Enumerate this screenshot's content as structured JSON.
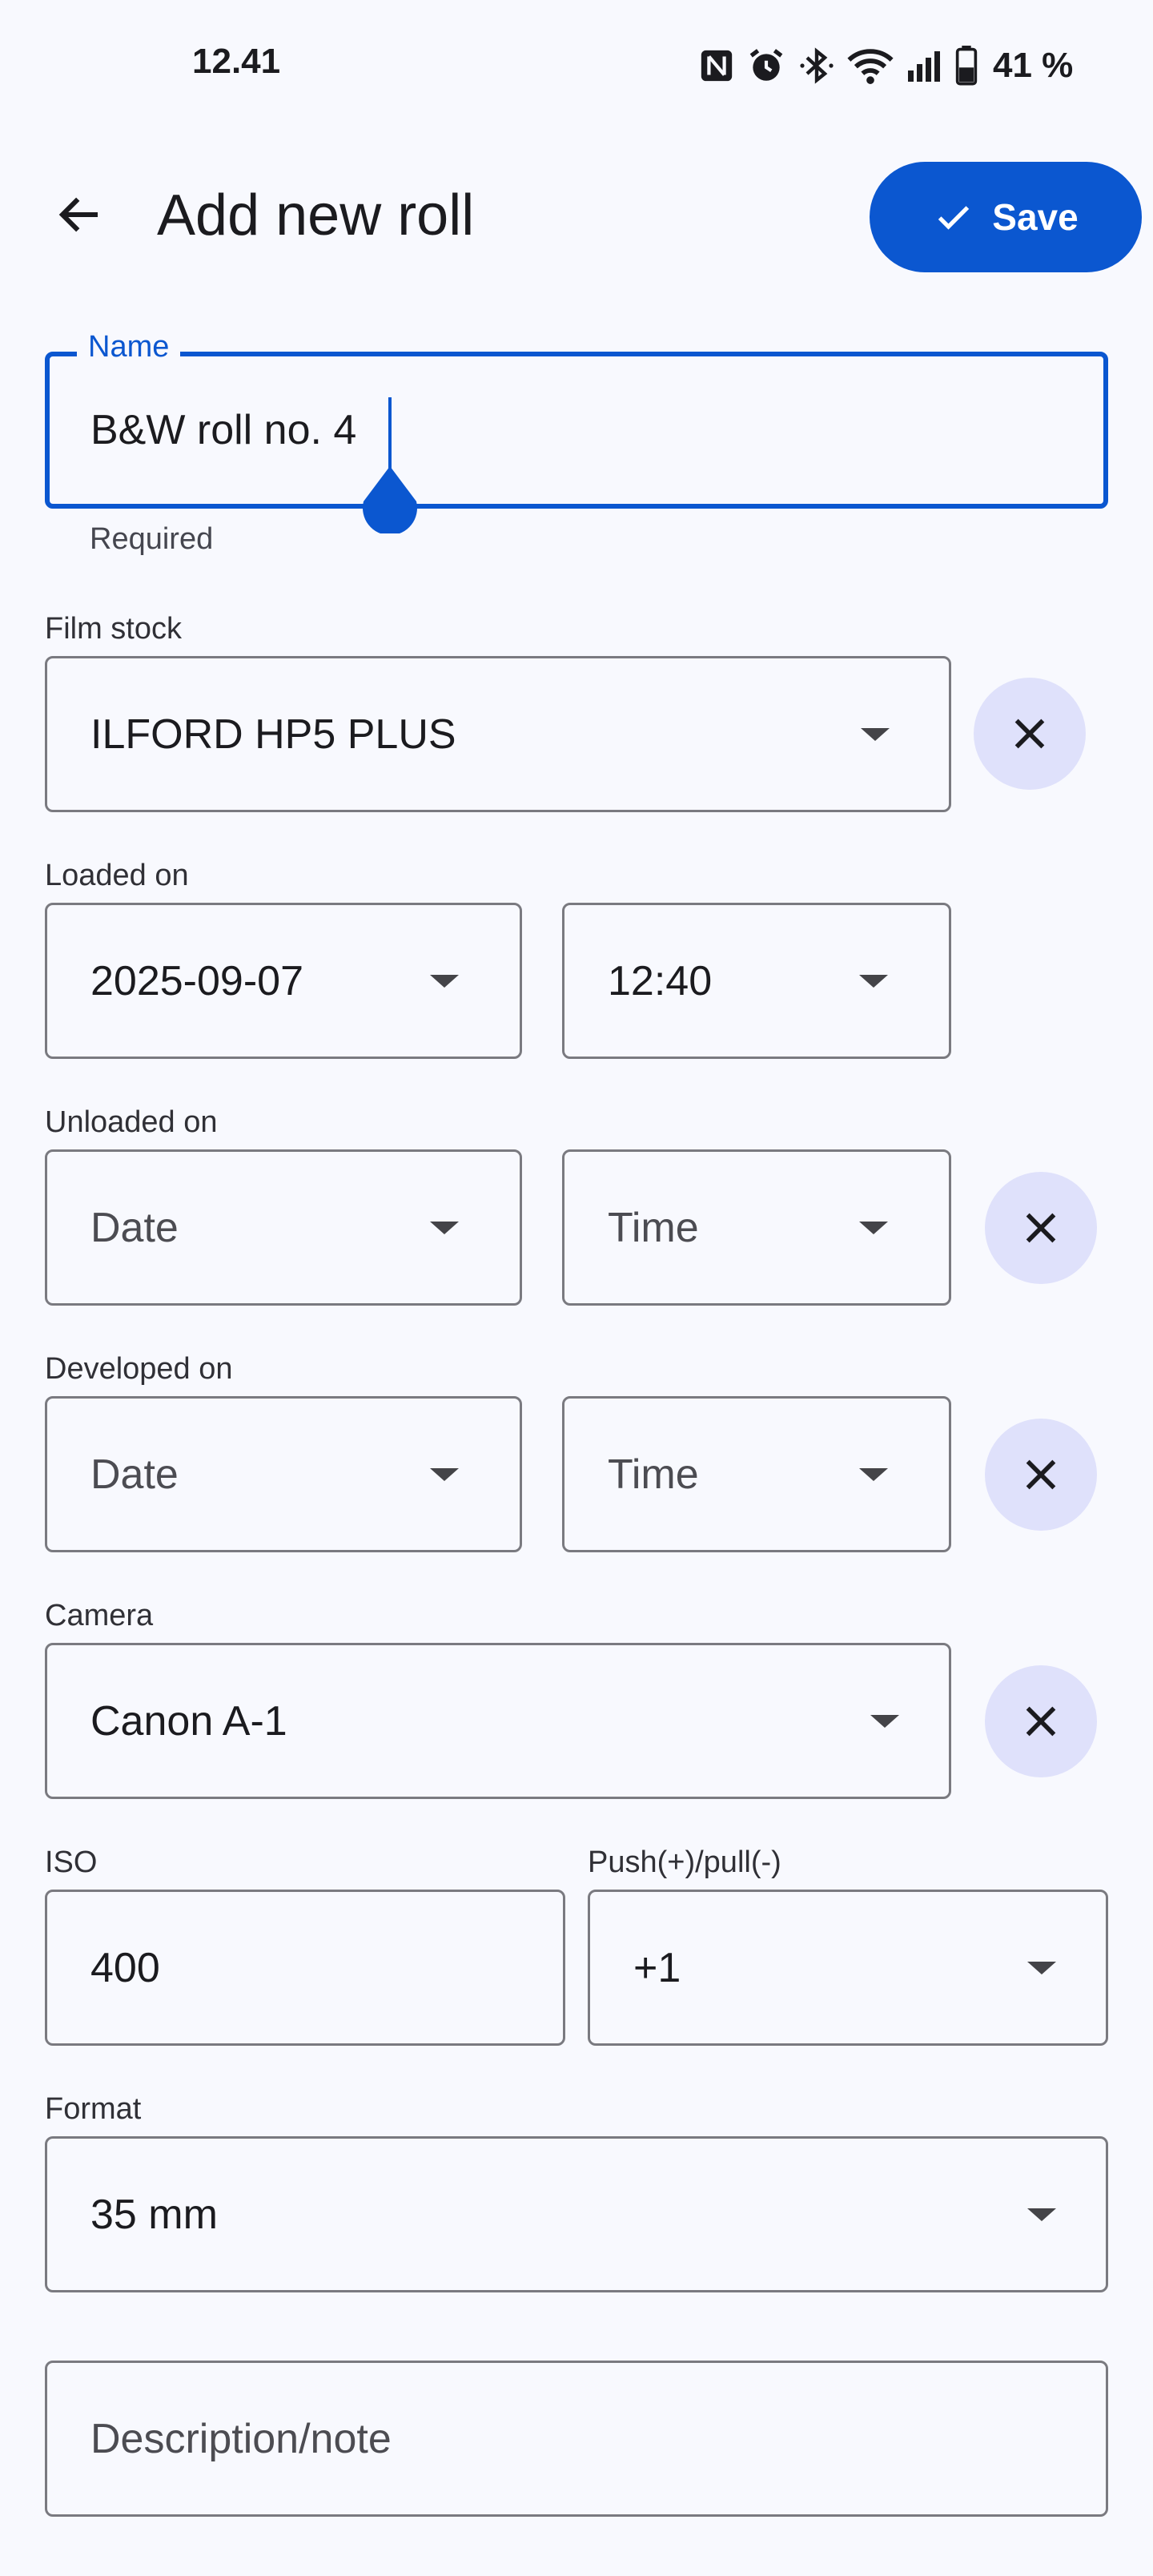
{
  "status_bar": {
    "time": "12.41",
    "battery": "41 %",
    "icons": [
      "nfc-icon",
      "alarm-icon",
      "bluetooth-icon",
      "wifi-icon",
      "signal-icon",
      "battery-icon"
    ]
  },
  "app_bar": {
    "title": "Add new roll",
    "save_label": "Save",
    "back_icon": "arrow-back-icon",
    "save_icon": "check-icon"
  },
  "form": {
    "name": {
      "label": "Name",
      "value": "B&W roll no. 4",
      "helper": "Required"
    },
    "film_stock": {
      "label": "Film stock",
      "value": "ILFORD HP5 PLUS"
    },
    "loaded_on": {
      "label": "Loaded on",
      "date": "2025-09-07",
      "time": "12:40"
    },
    "unloaded_on": {
      "label": "Unloaded on",
      "date": "Date",
      "time": "Time"
    },
    "developed_on": {
      "label": "Developed on",
      "date": "Date",
      "time": "Time"
    },
    "camera": {
      "label": "Camera",
      "value": "Canon A-1"
    },
    "iso": {
      "label": "ISO",
      "value": "400"
    },
    "push_pull": {
      "label": "Push(+)/pull(-)",
      "value": "+1"
    },
    "format": {
      "label": "Format",
      "value": "35 mm"
    },
    "description": {
      "placeholder": "Description/note"
    }
  },
  "colors": {
    "accent": "#0b57d0",
    "background": "#f8f9fe",
    "clear_button_bg": "#dfe1fb"
  }
}
